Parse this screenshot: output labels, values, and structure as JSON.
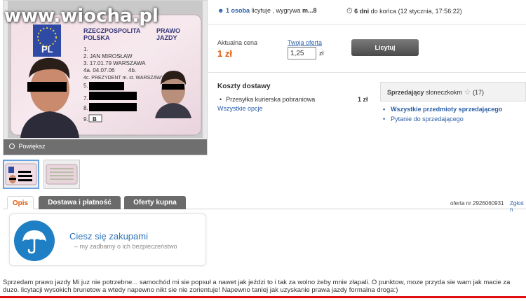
{
  "watermark": "www.wiocha.pl",
  "gallery": {
    "zoom_label": "Powiększ",
    "license": {
      "country_line1": "RZECZPOSPOLITA",
      "country_line2": "POLSKA",
      "doc_line1": "PRAWO",
      "doc_line2": "JAZDY",
      "eu_code": "PL",
      "field1": "1.",
      "field2": "2.  JAN MIROSŁAW",
      "field3": "3.  17.01.79    WARSZAWA",
      "field4a": "4a. 04.07.06",
      "field4b": "4b.",
      "field4c": "4c. PREZYDENT m. st. WARSZAWY",
      "field5": "5.",
      "field7": "7.",
      "field8": "8.",
      "field9": "9.",
      "category": "B"
    }
  },
  "auction": {
    "bidders_count_link": "1 osoba",
    "bidders_text": " licytuje , wygrywa ",
    "leader": "m...8",
    "time_left": "6 dni",
    "end_text": " do końca (12 stycznia, 17:56:22)",
    "current_price_label": "Aktualna cena",
    "current_price": "1 zł",
    "your_offer_label": "Twoja oferta",
    "your_offer_value": "1,25",
    "currency": "zł",
    "bid_button": "Licytuj"
  },
  "delivery": {
    "title": "Koszty dostawy",
    "item": "Przesyłka kurierska pobraniowa",
    "item_price": "1 zł",
    "all_options": "Wszystkie opcje"
  },
  "seller": {
    "label": "Sprzedający",
    "name": " sloneczkokm",
    "rating": "(17)",
    "all_items_link": "Wszystkie przedmioty sprzedającego",
    "ask_link": "Pytanie do sprzedającego"
  },
  "tabs": [
    "Opis",
    "Dostawa i płatność",
    "Oferty kupna"
  ],
  "offer_number": "oferta nr 2926060931",
  "report_link": "Zgłoś n",
  "protection": {
    "title": "Ciesz się zakupami",
    "subtitle": "my zadbamy o ich bezpieczeństwo"
  },
  "description": "Sprzedam prawo jazdy Mi juz nie potrzebne... samochód mi sie popsuł a nawet jak jeździ to i tak za wolno żeby mnie złapali. O punktow, moze przyda sie wam jak macie za duzo. licytacji wysokich brunetow a wtedy napewno nikt sie nie zorientuje! Napewno taniej jak uzyskanie prawa jazdy formalna droga:)",
  "colors": {
    "accent_orange": "#e05a0c",
    "link_blue": "#2a5ea8",
    "highlight_red": "#e01010",
    "umbrella_blue": "#1f7fc4"
  }
}
